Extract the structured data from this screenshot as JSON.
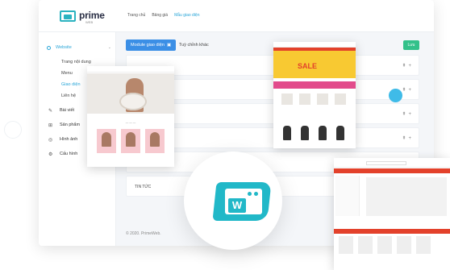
{
  "brand": {
    "name": "prime",
    "sub": "WEB"
  },
  "topnav": [
    "Trang chủ",
    "Bảng giá",
    "Mẫu giao diện"
  ],
  "sidebar": {
    "section": "Website",
    "sub_items": [
      "Trang nội dung",
      "Menu",
      "Giao diện",
      "Liên hệ"
    ],
    "main_items": [
      {
        "label": "Bài viết",
        "icon": "edit-icon"
      },
      {
        "label": "Sản phẩm",
        "icon": "cart-icon"
      },
      {
        "label": "Hình ảnh",
        "icon": "image-icon"
      },
      {
        "label": "Cấu hình",
        "icon": "gear-icon"
      }
    ]
  },
  "toolbar": {
    "module_button": "Module giao diện",
    "custom_tab": "Tuỳ chỉnh khác",
    "save_button": "Lưu"
  },
  "rows": [
    {
      "label": ""
    },
    {
      "label": ""
    },
    {
      "label": ""
    },
    {
      "label": ""
    },
    {
      "label": ""
    },
    {
      "label": "TIN TỨC"
    }
  ],
  "footer": "© 2020. PrimeWeb.",
  "cards": {
    "sale_text": "SALE"
  },
  "accent": "#21b8c8"
}
